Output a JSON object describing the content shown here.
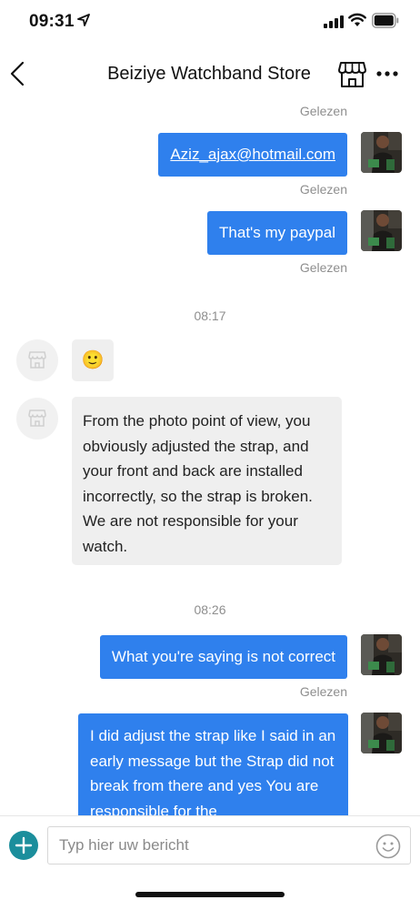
{
  "status_bar": {
    "time": "09:31"
  },
  "header": {
    "title": "Beiziye Watchband Store"
  },
  "messages": {
    "read_label_top": "Gelezen",
    "email": {
      "text": "Aziz_ajax@hotmail.com",
      "read": "Gelezen"
    },
    "paypal": {
      "text": "That's my paypal",
      "read": "Gelezen"
    },
    "time_1": "08:17",
    "shop_emoji": "🙂",
    "shop_reply": "From the photo point of view, you obviously adjusted the strap, and your front and back are installed incorrectly, so the strap is broken. We are not responsible for your watch.",
    "time_2": "08:26",
    "not_correct": {
      "text": "What you're saying is not correct",
      "read": "Gelezen"
    },
    "last_message": "I did adjust the strap like I said in an early message but the Strap did not break from there and yes You are responsible for the"
  },
  "composer": {
    "placeholder": "Typ hier uw bericht"
  },
  "colors": {
    "outgoing_bubble": "#2f80ed",
    "incoming_bubble": "#efefef",
    "plus_button": "#1b8e9c"
  }
}
